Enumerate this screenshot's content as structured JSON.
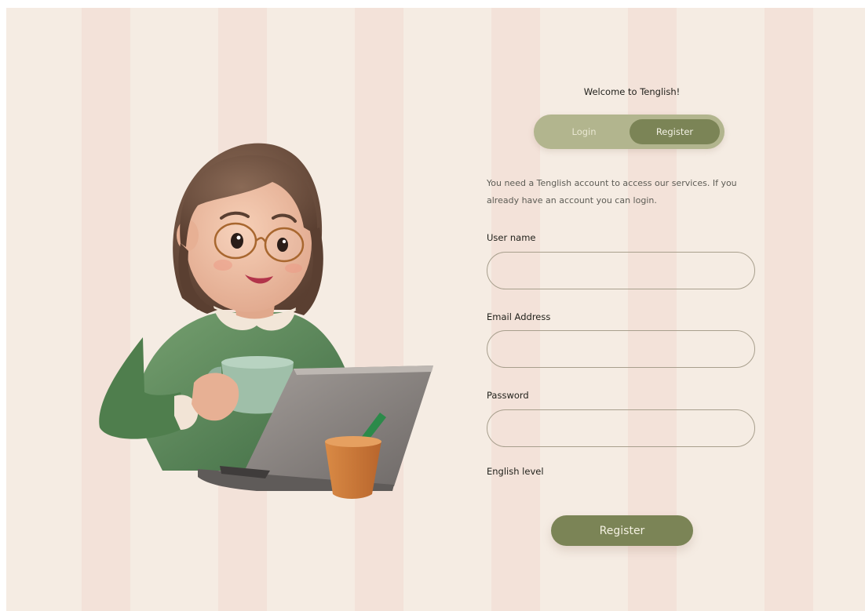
{
  "welcome": "Welcome to Tenglish!",
  "tabs": {
    "login": "Login",
    "register": "Register",
    "active": "Register"
  },
  "description": "You need a Tenglish account to access our services. If you already have an account you can login.",
  "fields": {
    "username": {
      "label": "User name",
      "value": ""
    },
    "email": {
      "label": "Email Address",
      "value": ""
    },
    "password": {
      "label": "Password",
      "value": ""
    },
    "english_level": {
      "label": "English level"
    }
  },
  "submit_label": "Register",
  "colors": {
    "accent": "#7b8456",
    "accent_light": "#b2b58e",
    "background": "#f5ece3",
    "stripe": "#f3e2d9"
  },
  "illustration": "girl-with-laptop-and-mug"
}
